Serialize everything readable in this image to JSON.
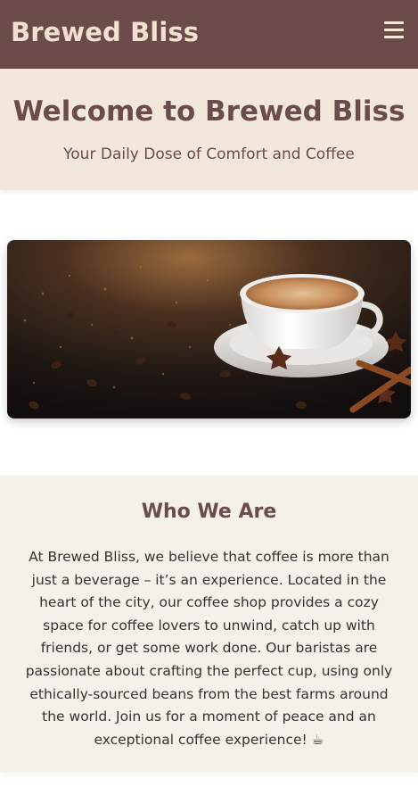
{
  "header": {
    "brand": "Brewed Bliss",
    "menu_icon": "hamburger-menu-icon"
  },
  "hero": {
    "title": "Welcome to Brewed Bliss",
    "subtitle": "Your Daily Dose of Comfort and Coffee"
  },
  "about": {
    "heading": "Who We Are",
    "body": "At Brewed Bliss, we believe that coffee is more than just a beverage – it’s an experience. Located in the heart of the city, our coffee shop provides a cozy space for coffee lovers to unwind, catch up with friends, or get some work done. Our baristas are passionate about crafting the perfect cup, using only ethically-sourced beans from the best farms around the world. Join us for a moment of peace and an exceptional coffee experience! ☕"
  },
  "colors": {
    "header_bg": "#6b4c4b",
    "brand_text": "#f3e1cf",
    "hero_bg": "#f3e6db",
    "about_bg": "#f6f0ea",
    "heading_text": "#6b4c4b"
  }
}
